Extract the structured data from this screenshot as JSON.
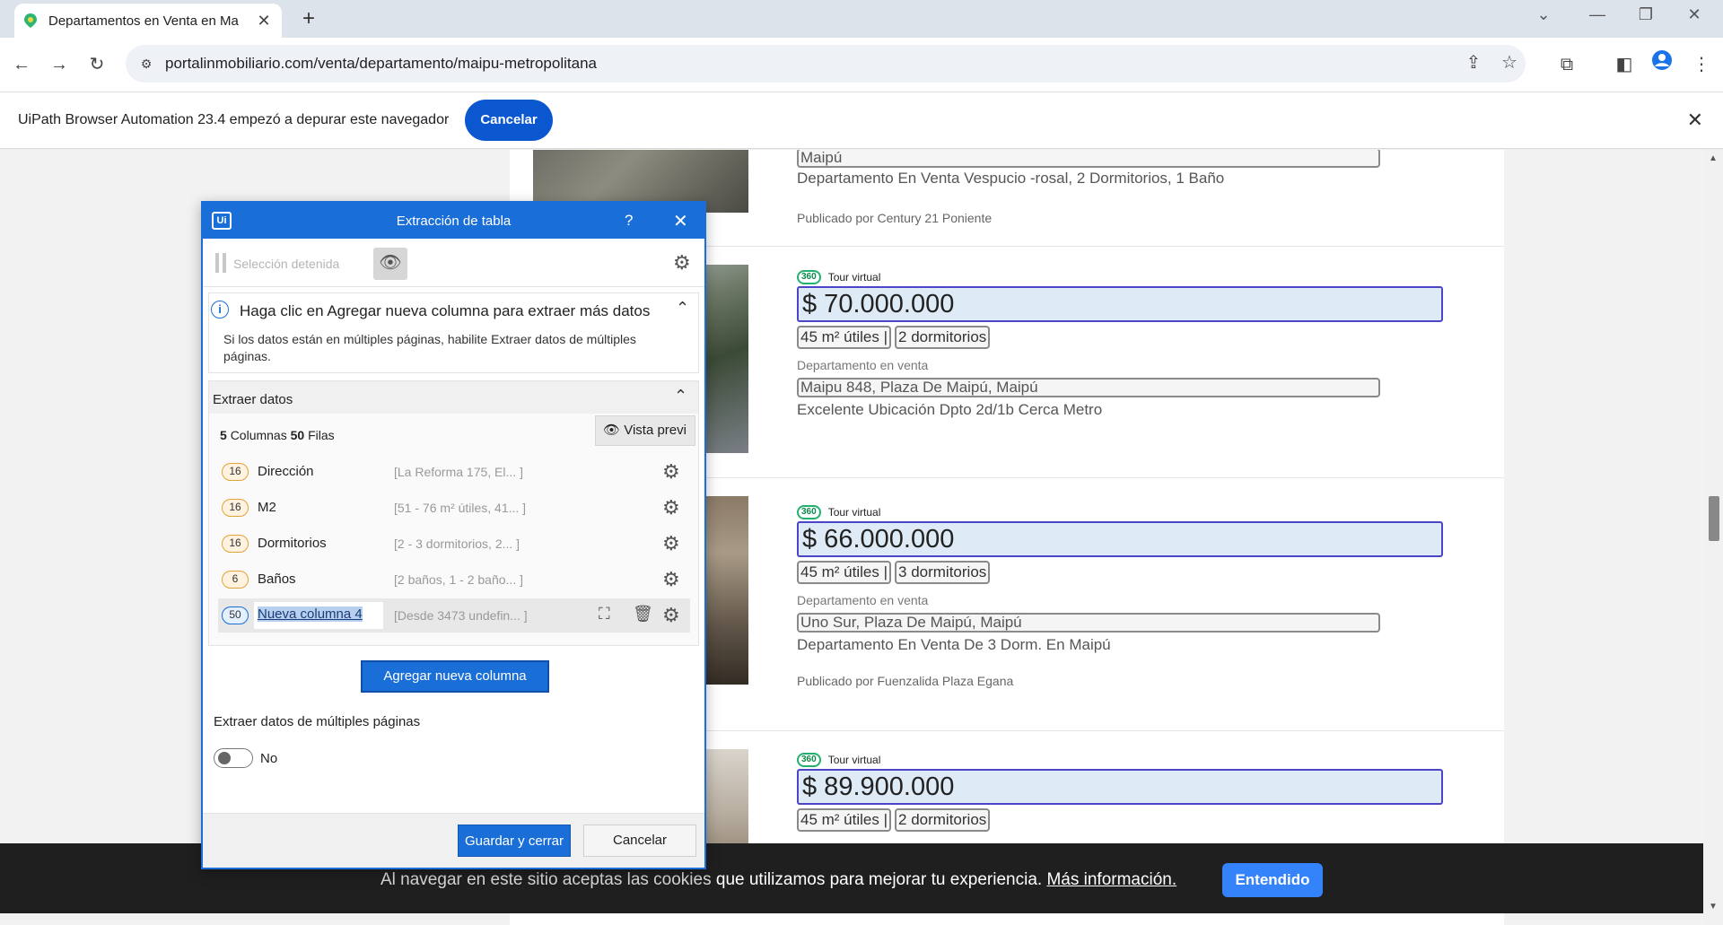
{
  "browser": {
    "tab_title": "Departamentos en Venta en Ma",
    "url": "portalinmobiliario.com/venta/departamento/maipu-metropolitana"
  },
  "infobar": {
    "message": "UiPath Browser Automation 23.4 empezó a depurar este navegador",
    "cancel_label": "Cancelar"
  },
  "listings": [
    {
      "location": "Maipú",
      "description": "Departamento En Venta Vespucio -rosal, 2 Dormitorios, 1 Baño",
      "publisher": "Publicado por Century 21 Poniente"
    },
    {
      "tour": "Tour virtual",
      "price": "$ 70.000.000",
      "area": "45 m² útiles |",
      "rooms": "2 dormitorios",
      "type": "Departamento en venta",
      "address": "Maipu 848, Plaza De Maipú, Maipú",
      "description": "Excelente Ubicación Dpto 2d/1b Cerca Metro"
    },
    {
      "tour": "Tour virtual",
      "price": "$ 66.000.000",
      "area": "45 m² útiles |",
      "rooms": "3 dormitorios",
      "type": "Departamento en venta",
      "address": "Uno Sur, Plaza De Maipú, Maipú",
      "description": "Departamento En Venta De 3 Dorm. En Maipú",
      "publisher": "Publicado por Fuenzalida Plaza Egana"
    },
    {
      "tour": "Tour virtual",
      "price": "$ 89.900.000",
      "area": "45 m² útiles |",
      "rooms": "2 dormitorios"
    }
  ],
  "cookie": {
    "text_before": "Al navegar en este sitio aceptas las cookies ",
    "text_bold": "que utilizamos para mejorar tu experiencia.",
    "link": "Más información.",
    "button": "Entendido"
  },
  "dialog": {
    "title": "Extracción de tabla",
    "logo": "Ui",
    "help": "?",
    "selection_status": "Selección detenida",
    "hint_title": "Haga clic en Agregar nueva columna para extraer más datos",
    "hint_text": "Si los datos están en múltiples páginas, habilite Extraer datos de múltiples páginas.",
    "extract_section": "Extraer datos",
    "columns_count": "5",
    "columns_label": "Columnas",
    "rows_count": "50",
    "rows_label": "Filas",
    "preview_button": "Vista previ",
    "columns": [
      {
        "count": "16",
        "name": "Dirección",
        "preview": "[La Reforma 175, El... ]"
      },
      {
        "count": "16",
        "name": "M2",
        "preview": "[51 - 76 m² útiles, 41... ]"
      },
      {
        "count": "16",
        "name": "Dormitorios",
        "preview": "[2 - 3 dormitorios, 2... ]"
      },
      {
        "count": "6",
        "name": "Baños",
        "preview": "[2 baños, 1 - 2 baño... ]"
      },
      {
        "count": "50",
        "name": "Nueva columna 4",
        "preview": "[Desde 3473 undefin... ]"
      }
    ],
    "add_column_button": "Agregar nueva columna",
    "multi_page_label": "Extraer datos de múltiples páginas",
    "multi_page_value": "No",
    "save_button": "Guardar y cerrar",
    "cancel_button": "Cancelar"
  }
}
